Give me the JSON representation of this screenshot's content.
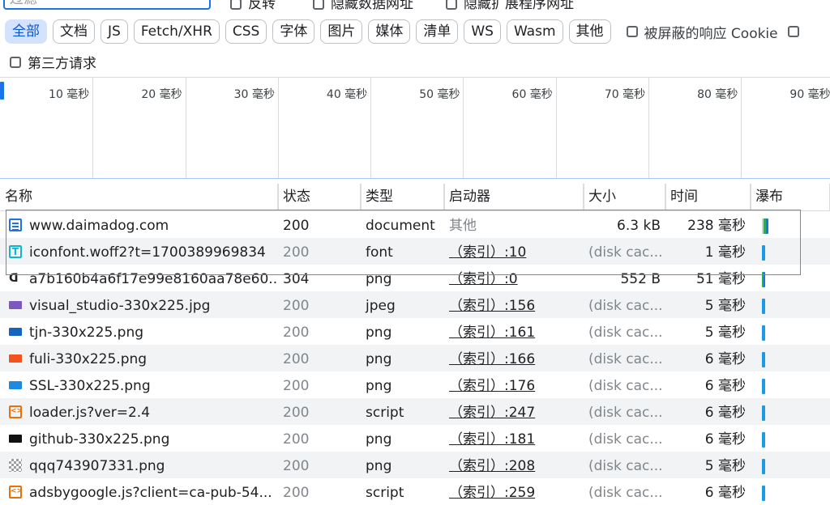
{
  "toolbar": {
    "filter_placeholder": "过滤",
    "invert_label": "反转",
    "hide_data_urls_label": "隐藏数据网址",
    "hide_extension_urls_label": "隐藏扩展程序网址"
  },
  "chips": [
    {
      "label": "全部",
      "active": true
    },
    {
      "label": "文档",
      "active": false
    },
    {
      "label": "JS",
      "active": false
    },
    {
      "label": "Fetch/XHR",
      "active": false
    },
    {
      "label": "CSS",
      "active": false
    },
    {
      "label": "字体",
      "active": false
    },
    {
      "label": "图片",
      "active": false
    },
    {
      "label": "媒体",
      "active": false
    },
    {
      "label": "清单",
      "active": false
    },
    {
      "label": "WS",
      "active": false
    },
    {
      "label": "Wasm",
      "active": false
    },
    {
      "label": "其他",
      "active": false
    }
  ],
  "blocked_cookies_label": "被屏蔽的响应 Cookie",
  "third_party_label": "第三方请求",
  "timeline_ticks": [
    "10 毫秒",
    "20 毫秒",
    "30 毫秒",
    "40 毫秒",
    "50 毫秒",
    "60 毫秒",
    "70 毫秒",
    "80 毫秒",
    "90 毫秒"
  ],
  "columns": [
    "名称",
    "状态",
    "类型",
    "启动器",
    "大小",
    "时间",
    "瀑布"
  ],
  "requests": [
    {
      "name": "www.daimadog.com",
      "status": "200",
      "type": "document",
      "initiator": "其他",
      "size": "6.3 kB",
      "time": "238 毫秒",
      "icon": "document-icon",
      "icon_color": "#1a73e8",
      "status_gray": false,
      "initiator_link": false,
      "size_gray": false
    },
    {
      "name": "iconfont.woff2?t=1700389969834",
      "status": "200",
      "type": "font",
      "initiator": "（索引）:10",
      "size": "(disk cac...",
      "time": "1 毫秒",
      "icon": "font-icon",
      "icon_color": "#12b5cb",
      "status_gray": true,
      "initiator_link": true,
      "size_gray": true
    },
    {
      "name": "a7b160b4a6f17e99e8160aa78e60...",
      "status": "304",
      "type": "png",
      "initiator": "（索引）:0",
      "size": "552 B",
      "time": "51 毫秒",
      "icon": "d-icon",
      "icon_color": "#202124",
      "status_gray": false,
      "initiator_link": true,
      "size_gray": false
    },
    {
      "name": "visual_studio-330x225.jpg",
      "status": "200",
      "type": "jpeg",
      "initiator": "（索引）:156",
      "size": "(disk cac...",
      "time": "5 毫秒",
      "icon": "image-thumbnail-icon",
      "icon_color": "#7e57c2",
      "status_gray": true,
      "initiator_link": true,
      "size_gray": true
    },
    {
      "name": "tjn-330x225.png",
      "status": "200",
      "type": "png",
      "initiator": "（索引）:161",
      "size": "(disk cac...",
      "time": "5 毫秒",
      "icon": "image-thumbnail-icon",
      "icon_color": "#1565c0",
      "status_gray": true,
      "initiator_link": true,
      "size_gray": true
    },
    {
      "name": "fuli-330x225.png",
      "status": "200",
      "type": "png",
      "initiator": "（索引）:166",
      "size": "(disk cac...",
      "time": "6 毫秒",
      "icon": "image-thumbnail-icon",
      "icon_color": "#f4511e",
      "status_gray": true,
      "initiator_link": true,
      "size_gray": true
    },
    {
      "name": "SSL-330x225.png",
      "status": "200",
      "type": "png",
      "initiator": "（索引）:176",
      "size": "(disk cac...",
      "time": "6 毫秒",
      "icon": "image-thumbnail-icon",
      "icon_color": "#1e88e5",
      "status_gray": true,
      "initiator_link": true,
      "size_gray": true
    },
    {
      "name": "loader.js?ver=2.4",
      "status": "200",
      "type": "script",
      "initiator": "（索引）:247",
      "size": "(disk cac...",
      "time": "6 毫秒",
      "icon": "script-icon",
      "icon_color": "#e8710a",
      "status_gray": true,
      "initiator_link": true,
      "size_gray": true
    },
    {
      "name": "github-330x225.png",
      "status": "200",
      "type": "png",
      "initiator": "（索引）:181",
      "size": "(disk cac...",
      "time": "6 毫秒",
      "icon": "image-thumbnail-icon",
      "icon_color": "#111111",
      "status_gray": true,
      "initiator_link": true,
      "size_gray": true
    },
    {
      "name": "qqq743907331.png",
      "status": "200",
      "type": "png",
      "initiator": "（索引）:208",
      "size": "(disk cac...",
      "time": "5 毫秒",
      "icon": "qr-thumbnail-icon",
      "icon_color": "#9e9e9e",
      "status_gray": true,
      "initiator_link": true,
      "size_gray": true
    },
    {
      "name": "adsbygoogle.js?client=ca-pub-54...",
      "status": "200",
      "type": "script",
      "initiator": "（索引）:259",
      "size": "(disk cac...",
      "time": "6 毫秒",
      "icon": "script-icon",
      "icon_color": "#e8710a",
      "status_gray": true,
      "initiator_link": true,
      "size_gray": true
    }
  ],
  "colors": {
    "accent": "#1a73e8",
    "active_chip_bg": "#d3e3fd",
    "selection_outline": "#e06060"
  }
}
